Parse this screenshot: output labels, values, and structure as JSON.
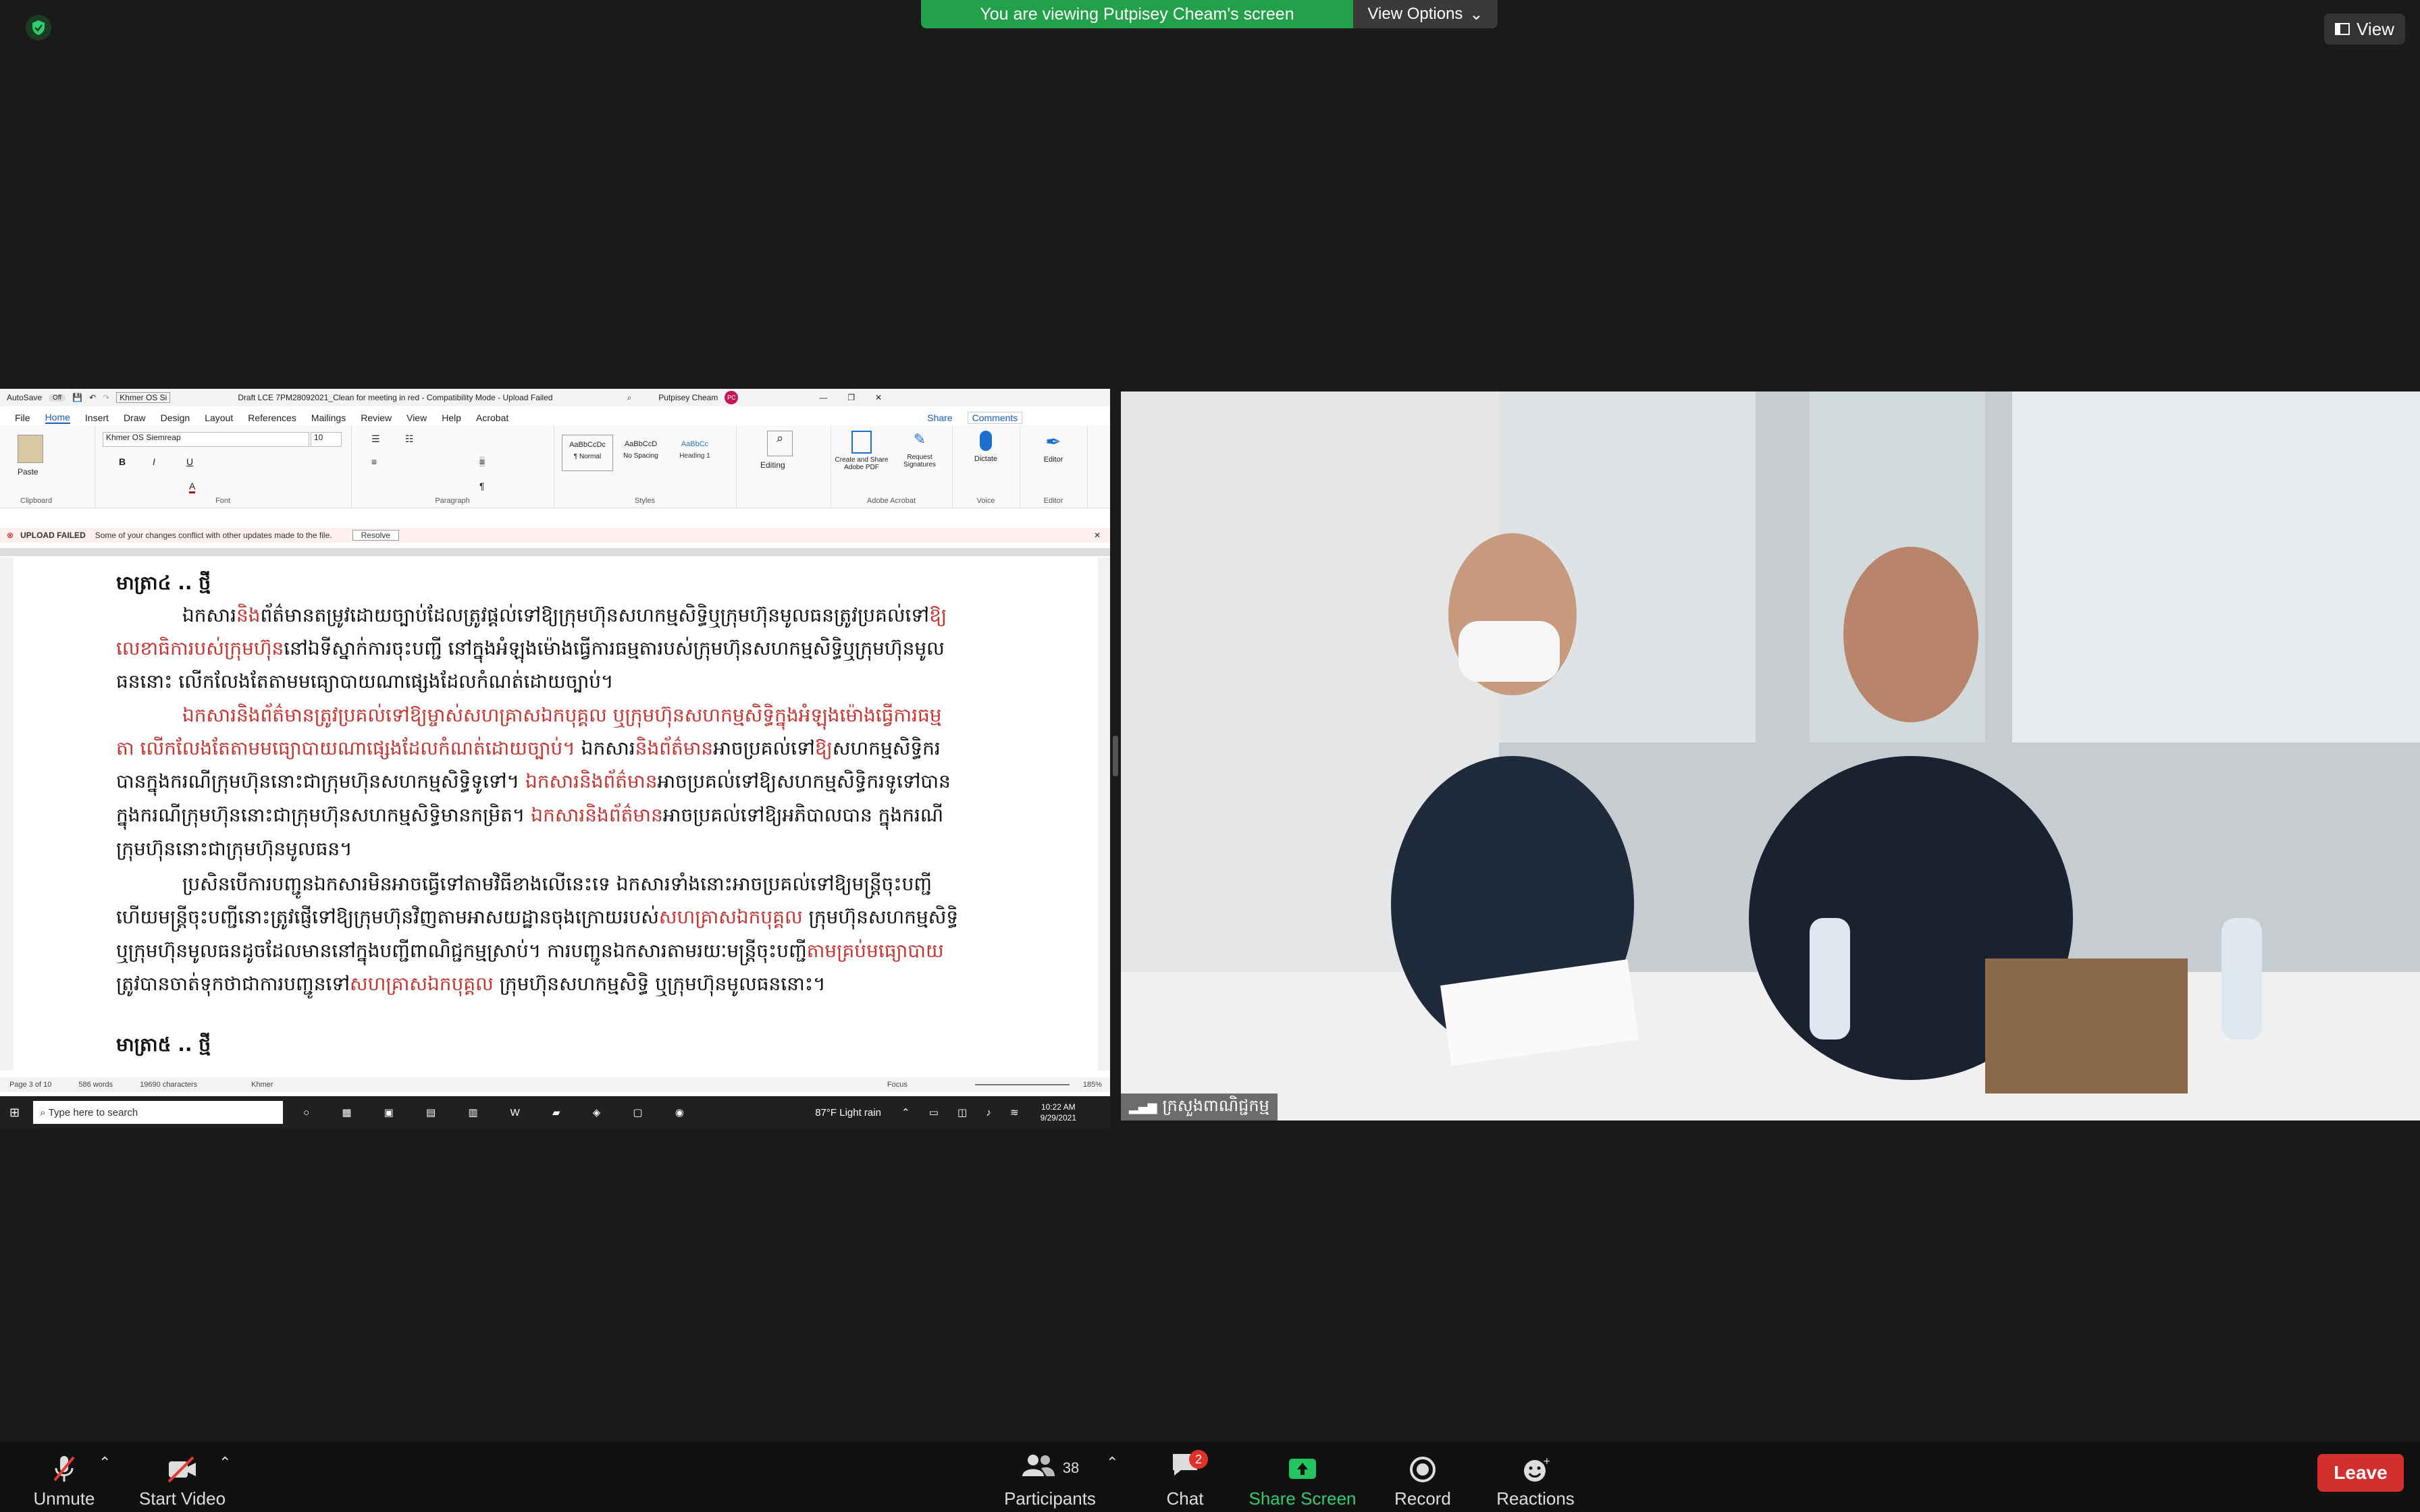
{
  "banner": {
    "message": "You are viewing Putpisey Cheam's screen",
    "view_options": "View Options"
  },
  "view_button": "View",
  "word": {
    "autosave": "AutoSave",
    "autosave_state": "Off",
    "font_quick": "Khmer OS Si",
    "doc_title": "Draft LCE 7PM28092021_Clean for meeting in red  -  Compatibility Mode  -  Upload Failed",
    "user": "Putpisey Cheam",
    "user_initials": "PC",
    "menus": [
      "File",
      "Home",
      "Insert",
      "Draw",
      "Design",
      "Layout",
      "References",
      "Mailings",
      "Review",
      "View",
      "Help",
      "Acrobat"
    ],
    "share": "Share",
    "comments": "Comments",
    "font_name": "Khmer OS Siemreap",
    "font_size": "10",
    "styles": [
      {
        "preview": "AaBbCcDc",
        "name": "¶ Normal"
      },
      {
        "preview": "AaBbCcD",
        "name": "No Spacing"
      },
      {
        "preview": "AaBbCc",
        "name": "Heading 1"
      }
    ],
    "editing": "Editing",
    "create_pdf": "Create and Share Adobe PDF",
    "request_sign": "Request Signatures",
    "dictate": "Dictate",
    "editor": "Editor",
    "group_labels": {
      "clipboard": "Clipboard",
      "font": "Font",
      "paragraph": "Paragraph",
      "styles": "Styles",
      "acrobat": "Adobe Acrobat",
      "voice": "Voice",
      "editor": "Editor"
    },
    "paste": "Paste",
    "upload": {
      "label": "UPLOAD FAILED",
      "message": "Some of your changes conflict with other updates made to the file.",
      "resolve": "Resolve"
    },
    "status": {
      "page": "Page 3 of 10",
      "words": "586 words",
      "chars": "19690 characters",
      "lang": "Khmer",
      "focus": "Focus",
      "zoom": "185%"
    },
    "taskbar": {
      "search": "Type here to search",
      "weather": "87°F  Light rain",
      "time": "10:22 AM",
      "date": "9/29/2021"
    }
  },
  "doc": {
    "lines": [
      {
        "segments": [
          {
            "t": "មាត្រា៤ .. ថ្មី",
            "red": false
          }
        ],
        "bold": true,
        "indent": 0
      },
      {
        "segments": [
          {
            "t": "ឯកសារ",
            "red": false
          },
          {
            "t": "និង",
            "red": true
          },
          {
            "t": "ព័ត៌មានតម្រូវដោយច្បាប់ដែលត្រូវផ្តល់ទៅឱ្យក្រុមហ៊ុនសហកម្មសិទ្ធិឬក្រុមហ៊ុនមូលធនត្រូវប្រគល់ទៅ",
            "red": false
          },
          {
            "t": "ឱ្យ",
            "red": true
          }
        ],
        "bold": false,
        "indent": 1
      },
      {
        "segments": [
          {
            "t": "លេខាធិការបស់ក្រុមហ៊ុន",
            "red": true
          },
          {
            "t": "នៅឯទីស្នាក់ការចុះបញ្ជី  នៅក្នុងអំឡុងម៉ោងធ្វើការធម្មតារបស់ក្រុមហ៊ុនសហកម្មសិទ្ធិឬក្រុមហ៊ុនមូល",
            "red": false
          }
        ],
        "bold": false,
        "indent": 0
      },
      {
        "segments": [
          {
            "t": "ធននោះ  លើកលែងតែតាមមធ្យោបាយណាផ្សេងដែលកំណត់ដោយច្បាប់។",
            "red": false
          }
        ],
        "bold": false,
        "indent": 0
      },
      {
        "segments": [
          {
            "t": "ឯកសារនិងព័ត៌មានត្រូវប្រគល់ទៅឱ្យម្ចាស់សហគ្រាសឯកបុគ្គល    ឬក្រុមហ៊ុនសហកម្មសិទ្ធិក្នុងអំឡុងម៉ោងធ្វើការធម្ម",
            "red": true
          }
        ],
        "bold": false,
        "indent": 1
      },
      {
        "segments": [
          {
            "t": "តា   លើកលែងតែតាមមធ្យោបាយណាផ្សេងដែលកំណត់ដោយច្បាប់។",
            "red": true
          },
          {
            "t": " ឯកសារ",
            "red": false
          },
          {
            "t": "និងព័ត៌មាន",
            "red": true
          },
          {
            "t": "អាចប្រគល់ទៅ",
            "red": false
          },
          {
            "t": "ឱ្យ",
            "red": true
          },
          {
            "t": "សហកម្មសិទ្ធិករ",
            "red": false
          }
        ],
        "bold": false,
        "indent": 0
      },
      {
        "segments": [
          {
            "t": "បានក្នុងករណីក្រុមហ៊ុននោះជាក្រុមហ៊ុនសហកម្មសិទ្ធិទូទៅ។ ",
            "red": false
          },
          {
            "t": "ឯកសារនិងព័ត៌មាន",
            "red": true
          },
          {
            "t": "អាចប្រគល់ទៅឱ្យសហកម្មសិទ្ធិករទូទៅបាន",
            "red": false
          }
        ],
        "bold": false,
        "indent": 0
      },
      {
        "segments": [
          {
            "t": "ក្នុងករណីក្រុមហ៊ុននោះជាក្រុមហ៊ុនសហកម្មសិទ្ធិមានកម្រិត។ ",
            "red": false
          },
          {
            "t": "ឯកសារនិងព័ត៌មាន",
            "red": true
          },
          {
            "t": "អាចប្រគល់ទៅឱ្យអភិបាលបាន  ក្នុងករណី",
            "red": false
          }
        ],
        "bold": false,
        "indent": 0
      },
      {
        "segments": [
          {
            "t": "ក្រុមហ៊ុននោះជាក្រុមហ៊ុនមូលធន។",
            "red": false
          }
        ],
        "bold": false,
        "indent": 0
      },
      {
        "segments": [
          {
            "t": "ប្រសិនបើការបញ្ជូនឯកសារមិនអាចធ្វើទៅតាមវិធីខាងលើនេះទេ     ឯកសារទាំងនោះអាចប្រគល់ទៅឱ្យមន្ត្រីចុះបញ្ជី",
            "red": false
          }
        ],
        "bold": false,
        "indent": 1
      },
      {
        "segments": [
          {
            "t": "ហើយមន្ត្រីចុះបញ្ជីនោះត្រូវផ្ញើទៅឱ្យក្រុមហ៊ុនវិញតាមអាសយដ្ឋានចុងក្រោយរបស់",
            "red": false
          },
          {
            "t": "សហគ្រាសឯកបុគ្គល",
            "red": true
          },
          {
            "t": " ក្រុមហ៊ុនសហកម្មសិទ្ធិ",
            "red": false
          }
        ],
        "bold": false,
        "indent": 0
      },
      {
        "segments": [
          {
            "t": "ឬក្រុមហ៊ុនមូលធនដូចដែលមាននៅក្នុងបញ្ជីពាណិជ្ជកម្មស្រាប់។  ការបញ្ជូនឯកសារតាមរយៈមន្ត្រីចុះបញ្ជី",
            "red": false
          },
          {
            "t": "តាមគ្រប់មធ្យោបាយ",
            "red": true
          }
        ],
        "bold": false,
        "indent": 0
      },
      {
        "segments": [
          {
            "t": "ត្រូវបានចាត់ទុកថាជាការបញ្ជូនទៅ",
            "red": false
          },
          {
            "t": "សហគ្រាសឯកបុគ្គល",
            "red": true
          },
          {
            "t": " ក្រុមហ៊ុនសហកម្មសិទ្ធិ  ឬក្រុមហ៊ុនមូលធននោះ។",
            "red": false
          }
        ],
        "bold": false,
        "indent": 0
      },
      {
        "segments": [
          {
            "t": "មាត្រា៥ .. ថ្មី",
            "red": false
          }
        ],
        "bold": true,
        "indent": 0
      }
    ]
  },
  "video": {
    "label": "ក្រសួងពាណិជ្ជកម្ម"
  },
  "toolbar": {
    "unmute": "Unmute",
    "start_video": "Start Video",
    "participants": "Participants",
    "participants_count": "38",
    "chat": "Chat",
    "chat_badge": "2",
    "share_screen": "Share Screen",
    "record": "Record",
    "reactions": "Reactions",
    "leave": "Leave"
  }
}
